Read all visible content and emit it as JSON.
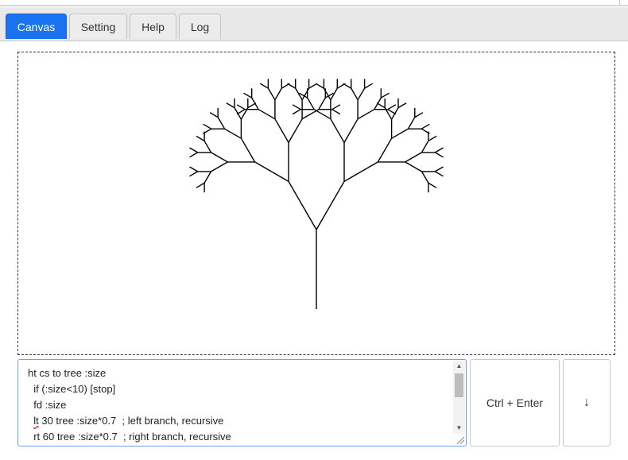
{
  "tabs": [
    {
      "label": "Canvas",
      "active": true
    },
    {
      "label": "Setting",
      "active": false
    },
    {
      "label": "Help",
      "active": false
    },
    {
      "label": "Log",
      "active": false
    }
  ],
  "editor": {
    "lines": [
      "ht cs to tree :size",
      "  if (:size<10) [stop]",
      "  fd :size",
      "  lt 30 tree :size*0.7  ; left branch, recursive",
      "  rt 60 tree :size*0.7  ; right branch, recursive"
    ]
  },
  "buttons": {
    "run_label": "Ctrl + Enter",
    "down_label": "↓"
  },
  "colors": {
    "active_tab": "#1a72ee",
    "editor_border": "#6aa0e8",
    "turtle_stroke": "#000000"
  },
  "turtle_drawing": {
    "program": "fractal binary tree",
    "base_size": 100,
    "scale": 0.7,
    "branch_angle_deg": 30,
    "stop_below": 10
  }
}
